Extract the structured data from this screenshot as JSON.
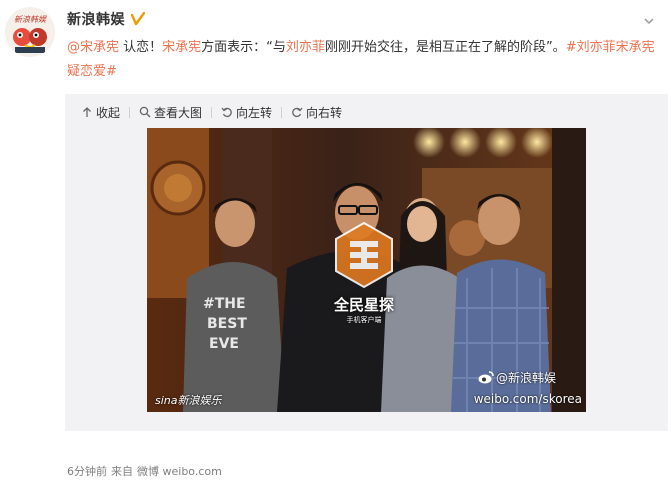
{
  "account": {
    "name": "新浪韩娱",
    "avatar_text": "新浪韩娱",
    "verified_color": "#f39800"
  },
  "post": {
    "mention1": "@宋承宪",
    "text1": " 认恋！",
    "mention2": "宋承宪",
    "text2": "方面表示：“与",
    "mention3": "刘亦菲",
    "text3": "刚刚开始交往，是相互正在了解的阶段”。",
    "hashtag1": "#刘亦菲宋承宪疑恋爱#",
    "link_color": "#eb7350"
  },
  "toolbar": {
    "collapse_label": "收起",
    "view_large_label": "查看大图",
    "rotate_left_label": "向左转",
    "rotate_right_label": "向右转"
  },
  "photo": {
    "watermark_left": "sina新浪娱乐",
    "watermark_center": "全民星探",
    "watermark_center_sub": "手机客户端",
    "watermark_weibo": "@新浪韩娱",
    "watermark_url": "weibo.com/skorea",
    "shirt_text_1": "#THE",
    "shirt_text_2": "BEST",
    "shirt_text_3": "EVE"
  },
  "footer": {
    "time": "6分钟前",
    "source_prefix": "来自",
    "source": "微博 weibo.com"
  }
}
